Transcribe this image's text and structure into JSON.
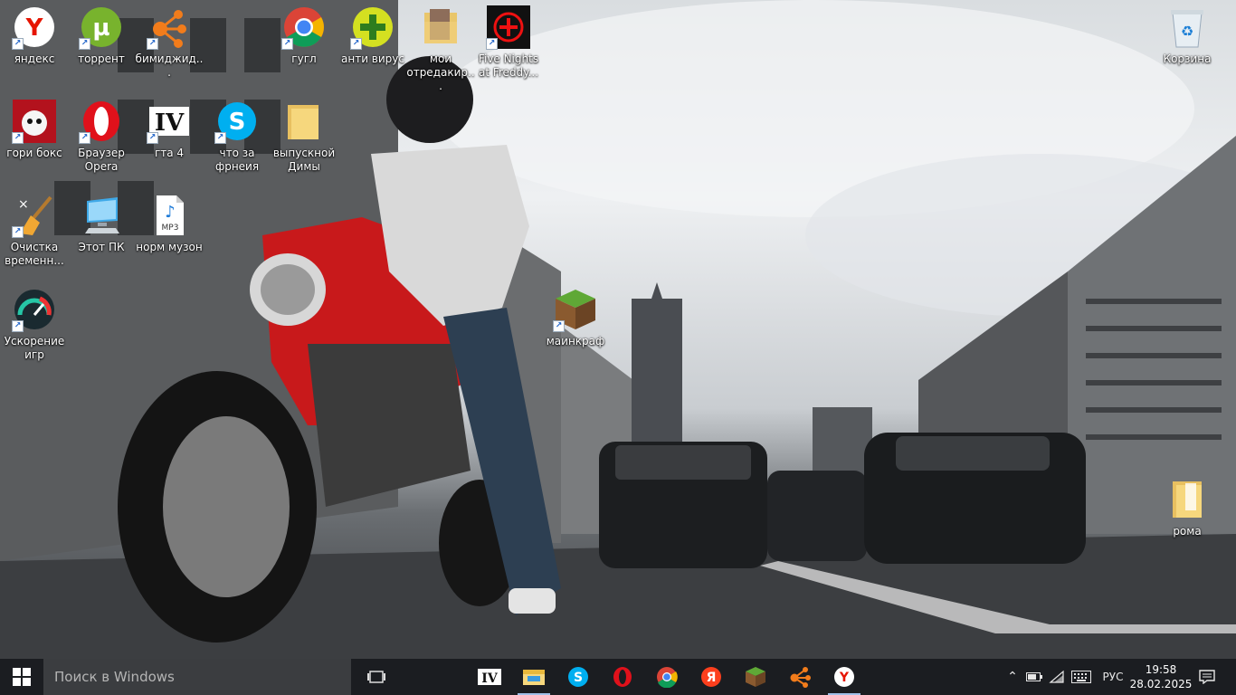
{
  "desktop": {
    "icons": [
      {
        "label": "яндекс",
        "icon": "yandex-browser-icon"
      },
      {
        "label": "торрент",
        "icon": "utorrent-icon"
      },
      {
        "label": "бимиджид...",
        "icon": "share-network-icon"
      },
      {
        "label": "гугл",
        "icon": "chrome-icon"
      },
      {
        "label": "анти вирус",
        "icon": "antivirus-plus-icon"
      },
      {
        "label": "мои отредакир...",
        "icon": "folder-document-icon"
      },
      {
        "label": "Five Nights at Freddy...",
        "icon": "fnaf-icon"
      },
      {
        "label": "гори бокс",
        "icon": "game-icon"
      },
      {
        "label": "Браузер Opera",
        "icon": "opera-icon"
      },
      {
        "label": "гта 4",
        "icon": "gta4-icon"
      },
      {
        "label": "что за фрнеия",
        "icon": "skype-icon"
      },
      {
        "label": "выпускной Димы",
        "icon": "folder-icon"
      },
      {
        "label": "Очистка временн...",
        "icon": "broom-cleaner-icon"
      },
      {
        "label": "Этот ПК",
        "icon": "computer-icon"
      },
      {
        "label": "норм музон",
        "icon": "mp3-file-icon"
      },
      {
        "label": "Ускорение игр",
        "icon": "speedometer-icon"
      },
      {
        "label": "маинкраф",
        "icon": "minecraft-icon"
      },
      {
        "label": "Корзина",
        "icon": "recycle-bin-icon"
      },
      {
        "label": "рома",
        "icon": "folder-icon"
      }
    ]
  },
  "taskbar": {
    "search_placeholder": "Поиск в Windows",
    "pinned": [
      {
        "name": "gta4",
        "icon": "gta4-icon"
      },
      {
        "name": "explorer",
        "icon": "file-explorer-icon"
      },
      {
        "name": "skype",
        "icon": "skype-icon"
      },
      {
        "name": "opera",
        "icon": "opera-icon"
      },
      {
        "name": "chrome",
        "icon": "chrome-icon"
      },
      {
        "name": "yandex",
        "icon": "yandex-icon"
      },
      {
        "name": "minecraft",
        "icon": "minecraft-icon"
      },
      {
        "name": "share",
        "icon": "share-network-icon"
      },
      {
        "name": "yandex-browser",
        "icon": "yandex-browser-icon"
      }
    ],
    "tray": {
      "language": "РУС",
      "time": "19:58",
      "date": "28.02.2025"
    }
  }
}
